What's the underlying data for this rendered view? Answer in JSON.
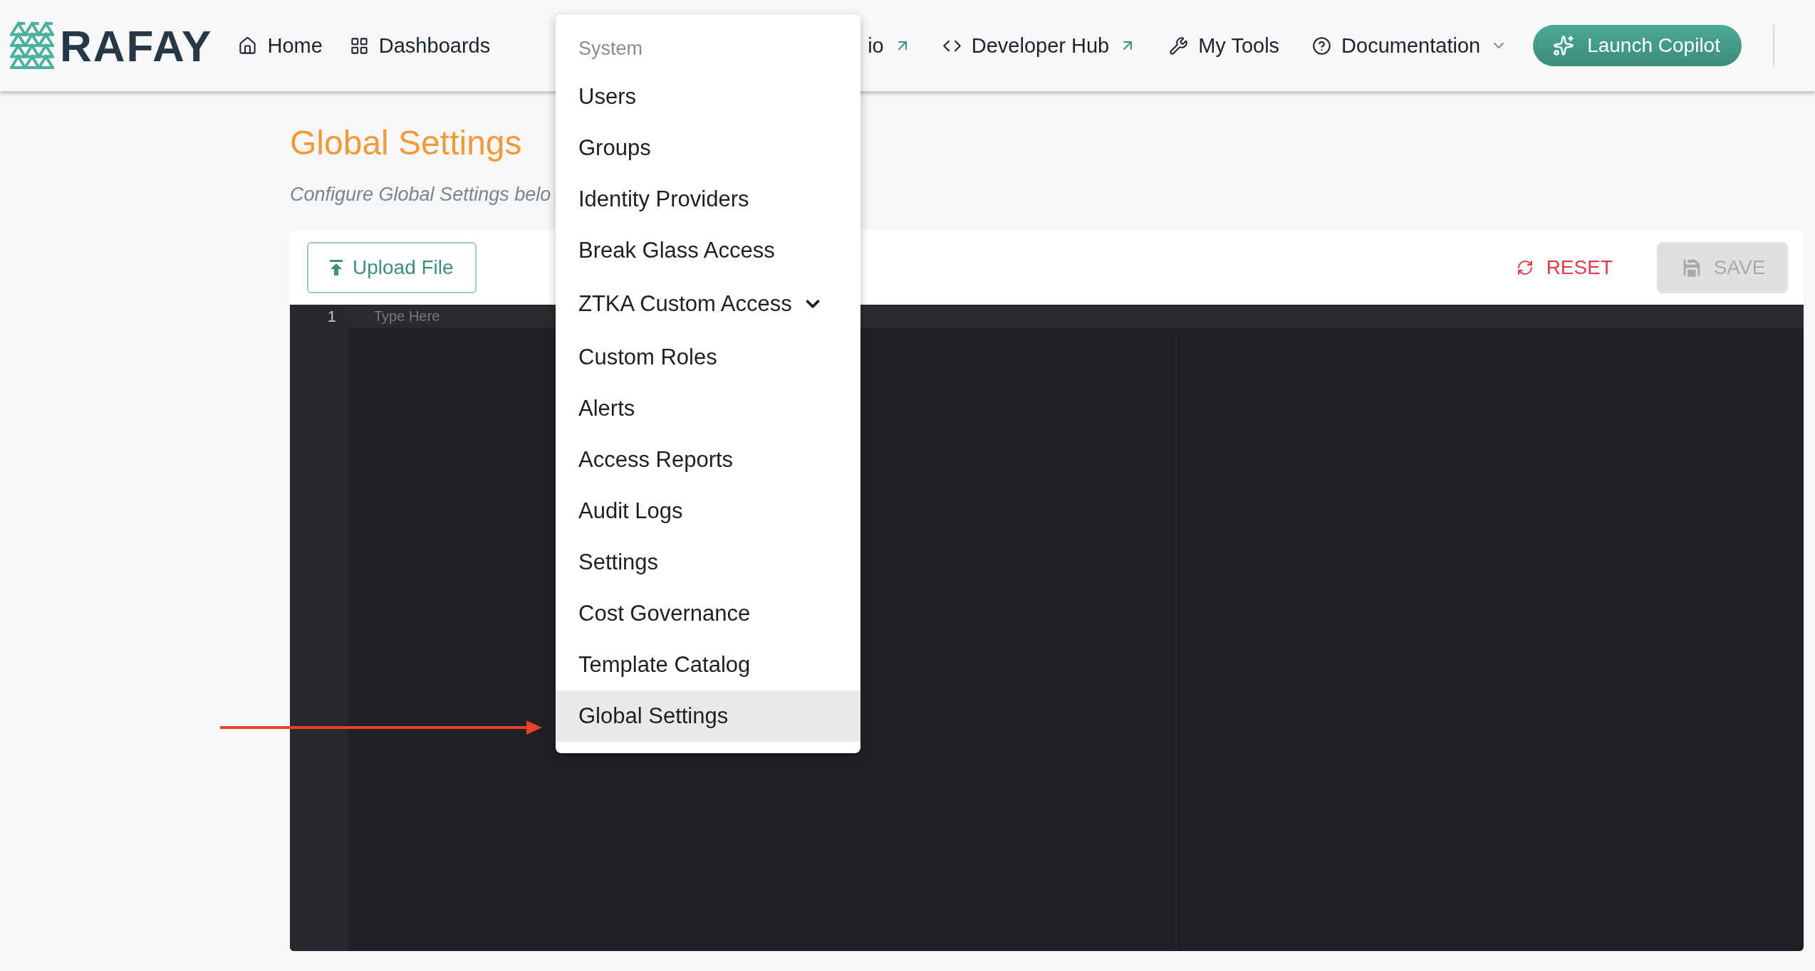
{
  "brand": {
    "name": "RAFAY"
  },
  "nav": [
    {
      "label": "Home",
      "external": false,
      "dropdown": false
    },
    {
      "label": "Dashboards",
      "external": false,
      "dropdown": false
    },
    {
      "label": "io",
      "external": true,
      "dropdown": false
    },
    {
      "label": "Developer Hub",
      "external": true,
      "dropdown": false
    },
    {
      "label": "My Tools",
      "external": false,
      "dropdown": false
    },
    {
      "label": "Documentation",
      "external": false,
      "dropdown": true
    }
  ],
  "copilot_button": {
    "label": "Launch Copilot"
  },
  "page": {
    "title": "Global Settings",
    "subtitle": "Configure Global Settings belo"
  },
  "toolbar": {
    "upload": "Upload File",
    "reset": "RESET",
    "save": {
      "label": "SAVE",
      "disabled": true
    }
  },
  "editor": {
    "line_numbers": [
      "1"
    ],
    "placeholder": "Type Here"
  },
  "menu": {
    "header": "System",
    "items": [
      {
        "label": "Users",
        "kind": "link",
        "selected": false
      },
      {
        "label": "Groups",
        "kind": "link",
        "selected": false
      },
      {
        "label": "Identity Providers",
        "kind": "link",
        "selected": false
      },
      {
        "label": "Break Glass Access",
        "kind": "link",
        "selected": false
      },
      {
        "label": "ZTKA Custom Access",
        "kind": "group",
        "selected": false
      },
      {
        "label": "Custom Roles",
        "kind": "link",
        "selected": false
      },
      {
        "label": "Alerts",
        "kind": "link",
        "selected": false
      },
      {
        "label": "Access Reports",
        "kind": "link",
        "selected": false
      },
      {
        "label": "Audit Logs",
        "kind": "link",
        "selected": false
      },
      {
        "label": "Settings",
        "kind": "link",
        "selected": false
      },
      {
        "label": "Cost Governance",
        "kind": "link",
        "selected": false
      },
      {
        "label": "Template Catalog",
        "kind": "link",
        "selected": false
      },
      {
        "label": "Global Settings",
        "kind": "link",
        "selected": true
      }
    ]
  }
}
